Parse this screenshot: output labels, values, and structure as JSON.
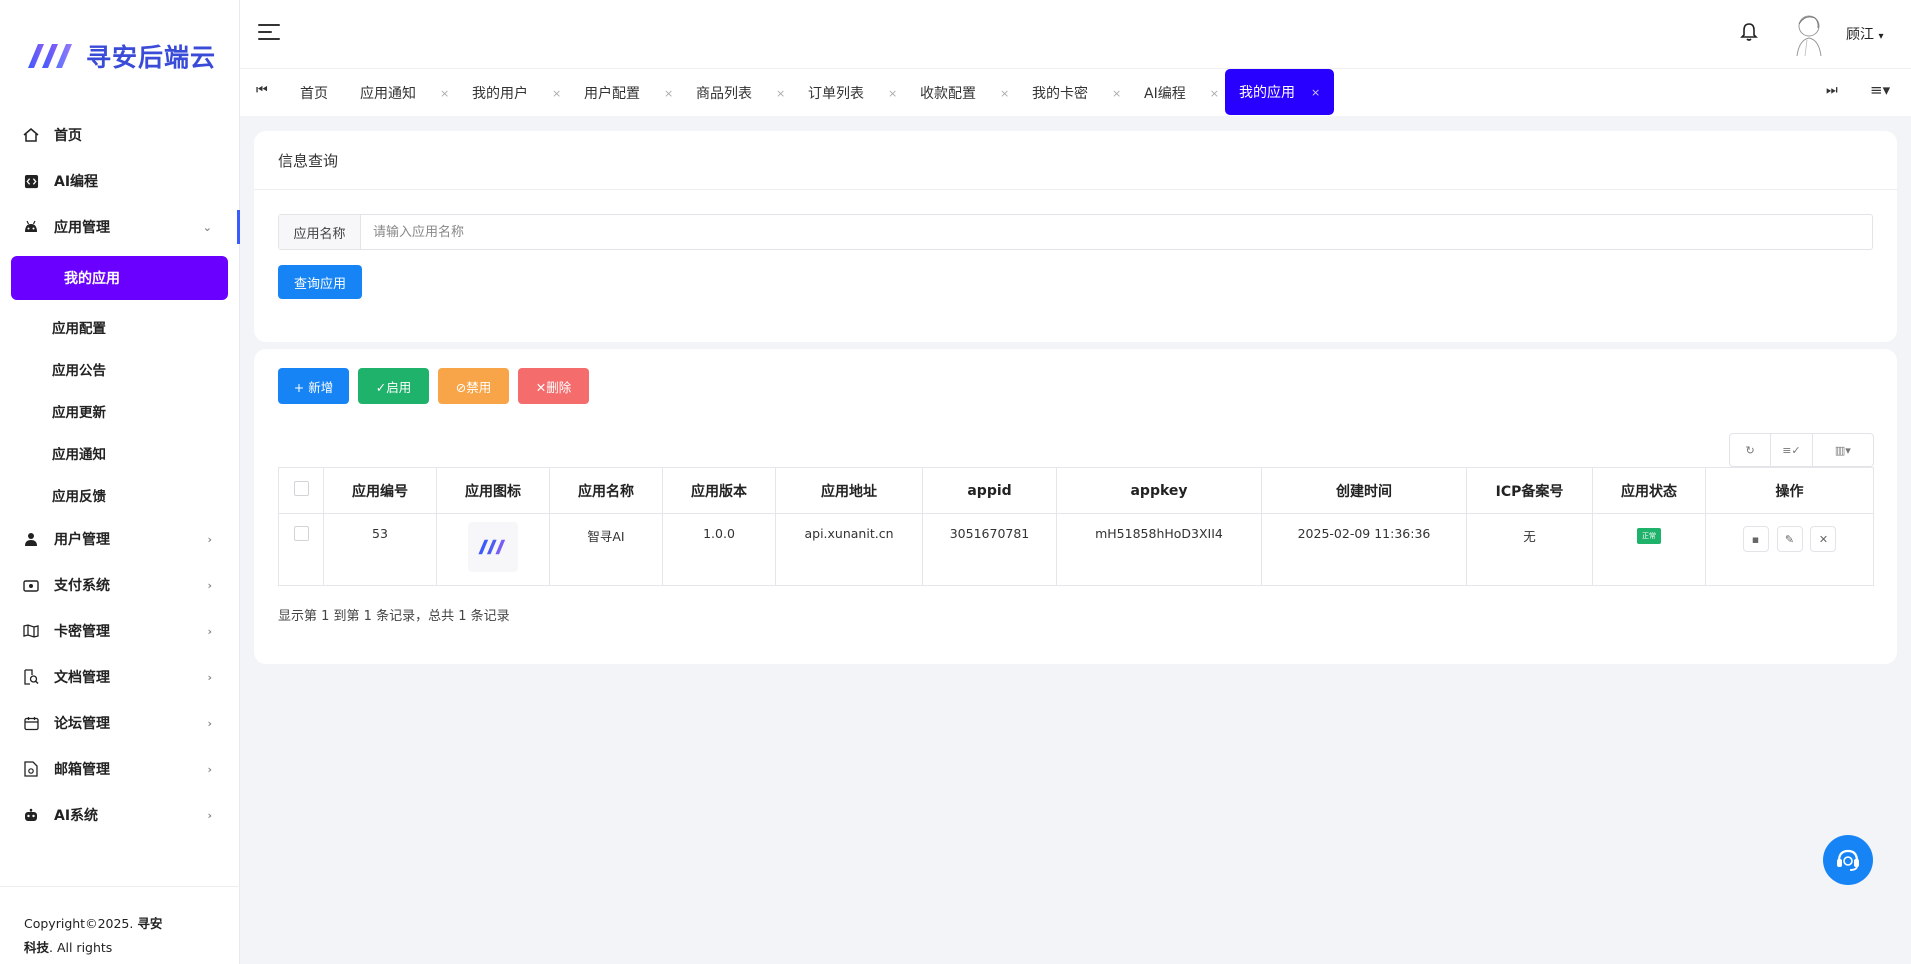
{
  "brand": {
    "name": "寻安后端云",
    "accent": "#3a4bd8"
  },
  "sidebar": {
    "items": [
      {
        "label": "首页",
        "icon": "home-icon"
      },
      {
        "label": "AI编程",
        "icon": "code-icon"
      },
      {
        "label": "应用管理",
        "icon": "android-icon",
        "expanded": true
      }
    ],
    "submenu": {
      "active": "我的应用",
      "items": [
        "应用配置",
        "应用公告",
        "应用更新",
        "应用通知",
        "应用反馈"
      ]
    },
    "items_after": [
      {
        "label": "用户管理",
        "icon": "user-icon"
      },
      {
        "label": "支付系统",
        "icon": "wallet-icon"
      },
      {
        "label": "卡密管理",
        "icon": "map-icon"
      },
      {
        "label": "文档管理",
        "icon": "doc-search-icon"
      },
      {
        "label": "论坛管理",
        "icon": "calendar-icon"
      },
      {
        "label": "邮箱管理",
        "icon": "mail-doc-icon"
      },
      {
        "label": "AI系统",
        "icon": "robot-icon"
      }
    ],
    "copyright_prefix": "Copyright©2025. ",
    "copyright_company": "寻安科技",
    "copyright_suffix": ". All rights reserved."
  },
  "header": {
    "username": "顾江"
  },
  "tabs": {
    "items": [
      "首页",
      "应用通知",
      "我的用户",
      "用户配置",
      "商品列表",
      "订单列表",
      "收款配置",
      "我的卡密",
      "AI编程"
    ],
    "active": "我的应用",
    "close_glyph": "×"
  },
  "search_card": {
    "title": "信息查询",
    "field_label": "应用名称",
    "field_placeholder": "请输入应用名称",
    "query_button": "查询应用"
  },
  "actions": {
    "add": "+ 新增",
    "enable": "✓启用",
    "disable": "⊘禁用",
    "delete": "✕删除"
  },
  "table": {
    "headers": [
      "应用编号",
      "应用图标",
      "应用名称",
      "应用版本",
      "应用地址",
      "appid",
      "appkey",
      "创建时间",
      "ICP备案号",
      "应用状态",
      "操作"
    ],
    "rows": [
      {
        "id": "53",
        "name": "智寻AI",
        "version": "1.0.0",
        "address": "api.xunanit.cn",
        "appid": "3051670781",
        "appkey": "mH51858hHoD3XII4",
        "created": "2025-02-09 11:36:36",
        "icp": "无",
        "status": "正常"
      }
    ]
  },
  "pager_text": "显示第 1 到第 1 条记录，总共 1 条记录"
}
